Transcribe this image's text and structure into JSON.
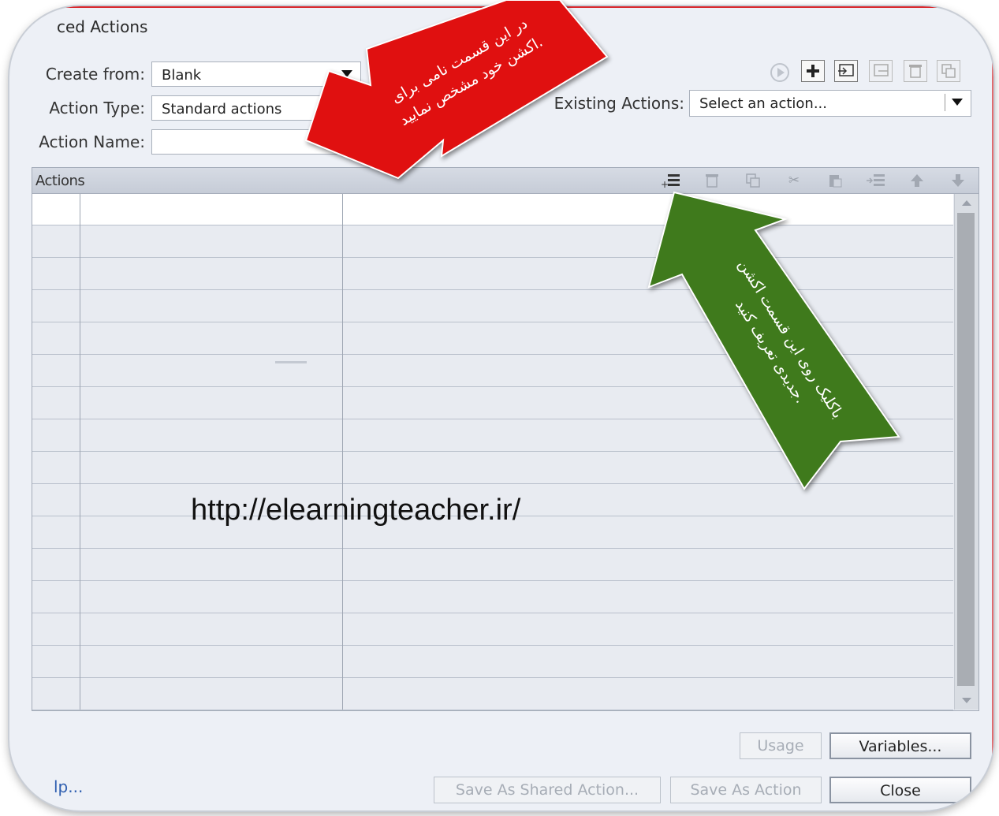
{
  "window": {
    "title": "ced Actions"
  },
  "form": {
    "create_from_label": "Create from:",
    "create_from_value": "Blank",
    "action_type_label": "Action Type:",
    "action_type_value": "Standard actions",
    "action_name_label": "Action Name:",
    "action_name_value": "",
    "existing_actions_label": "Existing Actions:",
    "existing_actions_value": "Select an action..."
  },
  "actions_panel": {
    "title": "Actions",
    "row_count": 16
  },
  "buttons": {
    "usage": "Usage",
    "variables": "Variables...",
    "save_shared": "Save As Shared Action...",
    "save_action": "Save As Action",
    "close": "Close",
    "help": "lp..."
  },
  "annotations": {
    "red_line1": "در این قسمت نامی برای",
    "red_line2": "اکشن خود مشخص نمایید.",
    "green_line1": "باکلیک روی این قسمت اکشن",
    "green_line2": "جدیدی تعریف کنید.",
    "url": "http://elearningteacher.ir/"
  },
  "colors": {
    "red_arrow": "#e01010",
    "green_arrow": "#3f7a1c"
  }
}
